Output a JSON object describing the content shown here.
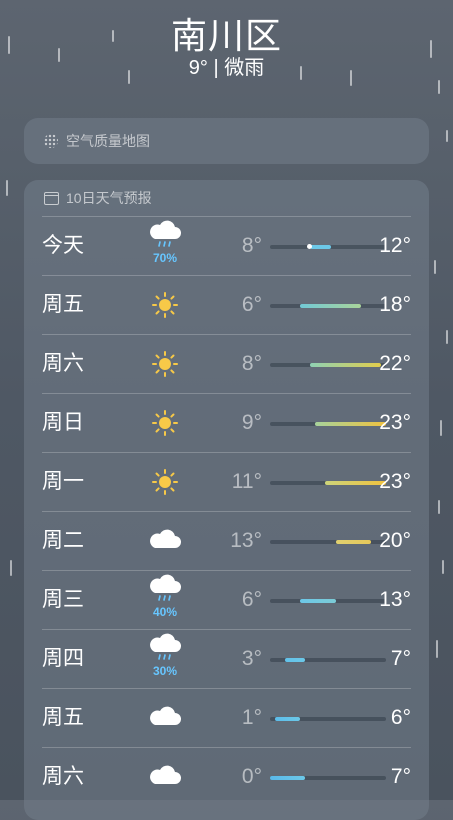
{
  "header": {
    "city": "南川区",
    "condition": "9° | 微雨"
  },
  "air_quality": {
    "label": "空气质量地图"
  },
  "forecast": {
    "title": "10日天气预报",
    "scale": {
      "min": 0,
      "max": 23
    },
    "current_temp": 9,
    "days": [
      {
        "day": "今天",
        "icon": "rain-cloud-icon",
        "precip": "70%",
        "low": "8°",
        "high": "12°",
        "low_val": 8,
        "high_val": 12,
        "colors": [
          "#6cc8e8",
          "#6cc8e8"
        ],
        "current": true
      },
      {
        "day": "周五",
        "icon": "sun-icon",
        "precip": "",
        "low": "6°",
        "high": "18°",
        "low_val": 6,
        "high_val": 18,
        "colors": [
          "#72c9d6",
          "#a9d49a"
        ]
      },
      {
        "day": "周六",
        "icon": "sun-icon",
        "precip": "",
        "low": "8°",
        "high": "22°",
        "low_val": 8,
        "high_val": 22,
        "colors": [
          "#8fd2b4",
          "#e2cd4c"
        ]
      },
      {
        "day": "周日",
        "icon": "sun-icon",
        "precip": "",
        "low": "9°",
        "high": "23°",
        "low_val": 9,
        "high_val": 23,
        "colors": [
          "#a7d39c",
          "#f0c23f"
        ]
      },
      {
        "day": "周一",
        "icon": "sun-icon",
        "precip": "",
        "low": "11°",
        "high": "23°",
        "low_val": 11,
        "high_val": 23,
        "colors": [
          "#cdd47a",
          "#f0c23f"
        ]
      },
      {
        "day": "周二",
        "icon": "cloud-icon",
        "precip": "",
        "low": "13°",
        "high": "20°",
        "low_val": 13,
        "high_val": 20,
        "colors": [
          "#e0d070",
          "#e6c85a"
        ]
      },
      {
        "day": "周三",
        "icon": "rain-cloud-icon",
        "precip": "40%",
        "low": "6°",
        "high": "13°",
        "low_val": 6,
        "high_val": 13,
        "colors": [
          "#6cc8e8",
          "#7ccbd6"
        ]
      },
      {
        "day": "周四",
        "icon": "rain-cloud-icon",
        "precip": "30%",
        "low": "3°",
        "high": "7°",
        "low_val": 3,
        "high_val": 7,
        "colors": [
          "#62c2ea",
          "#6cc8e8"
        ]
      },
      {
        "day": "周五",
        "icon": "cloud-icon",
        "precip": "",
        "low": "1°",
        "high": "6°",
        "low_val": 1,
        "high_val": 6,
        "colors": [
          "#5cbdea",
          "#6cc8e8"
        ]
      },
      {
        "day": "周六",
        "icon": "cloud-icon",
        "precip": "",
        "low": "0°",
        "high": "7°",
        "low_val": 0,
        "high_val": 7,
        "colors": [
          "#5ab9ea",
          "#6cc8e8"
        ]
      }
    ]
  }
}
